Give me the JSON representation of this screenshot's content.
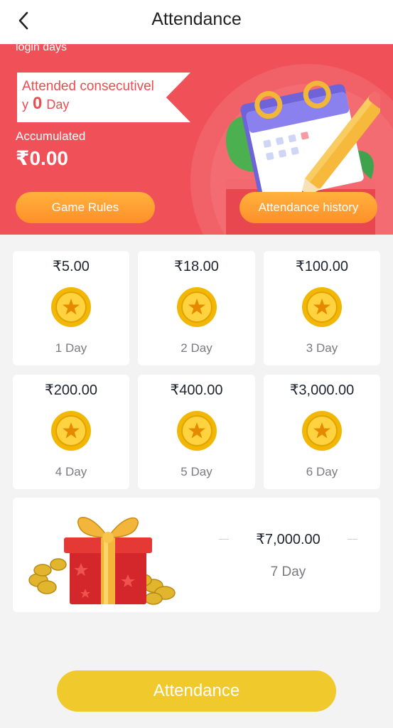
{
  "header": {
    "title": "Attendance",
    "back_icon": "chevron-left-icon"
  },
  "banner": {
    "login_days": "login days",
    "consecutive_prefix": "Attended consecutivel",
    "consecutive_mid": "y",
    "consecutive_count": "0",
    "consecutive_suffix": "Day",
    "accumulated_label": "Accumulated",
    "accumulated_value": "₹0.00",
    "rules_button": "Game Rules",
    "history_button": "Attendance history",
    "colors": {
      "background": "#f05057",
      "button": "#ff9f30"
    }
  },
  "rewards": [
    {
      "amount": "₹5.00",
      "day": "1 Day"
    },
    {
      "amount": "₹18.00",
      "day": "2 Day"
    },
    {
      "amount": "₹100.00",
      "day": "3 Day"
    },
    {
      "amount": "₹200.00",
      "day": "4 Day"
    },
    {
      "amount": "₹400.00",
      "day": "5 Day"
    },
    {
      "amount": "₹3,000.00",
      "day": "6 Day"
    }
  ],
  "final_reward": {
    "amount": "₹7,000.00",
    "day": "7 Day",
    "icon": "gift-box-icon"
  },
  "attendance_button": {
    "label": "Attendance",
    "color": "#f0c92d"
  }
}
